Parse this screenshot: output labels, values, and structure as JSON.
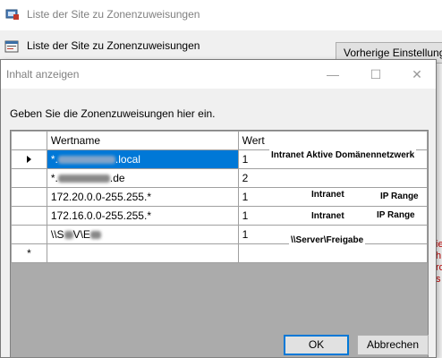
{
  "background_window": {
    "title": "Liste der Site zu Zonenzuweisungen",
    "header_text": "Liste der Site zu Zonenzuweisungen",
    "prev_button_label": "Vorherige Einstellung",
    "side_fragments": [
      "ie",
      "h",
      "rd",
      "s"
    ]
  },
  "dialog": {
    "title": "Inhalt anzeigen",
    "prompt": "Geben Sie die Zonenzuweisungen hier ein.",
    "columns": [
      "Wertname",
      "Wert"
    ],
    "rows": [
      {
        "name_prefix": "*.",
        "name_suffix": ".local",
        "value": "1",
        "selected": true
      },
      {
        "name_prefix": "*.",
        "name_suffix": ".de",
        "value": "2",
        "selected": false
      },
      {
        "name": "172.20.0.0-255.255.*",
        "value": "1",
        "selected": false
      },
      {
        "name": "172.16.0.0-255.255.*",
        "value": "1",
        "selected": false
      },
      {
        "name_prefix": "\\\\S",
        "name_mid": "V\\E",
        "value": "1",
        "selected": false
      }
    ],
    "new_row_marker": "*",
    "annotations": {
      "row1": "Intranet Aktive Domänennetzwerk",
      "row3_a": "Intranet",
      "row3_b": "IP Range",
      "row4_a": "Intranet",
      "row4_b": "IP Range",
      "row5": "\\\\Server\\Freigabe"
    },
    "ok_label": "OK",
    "cancel_label": "Abbrechen",
    "minimize_glyph": "—",
    "maximize_glyph": "☐",
    "close_glyph": "✕"
  },
  "colors": {
    "selection": "#0078d7",
    "annotation_text": "#000000"
  }
}
